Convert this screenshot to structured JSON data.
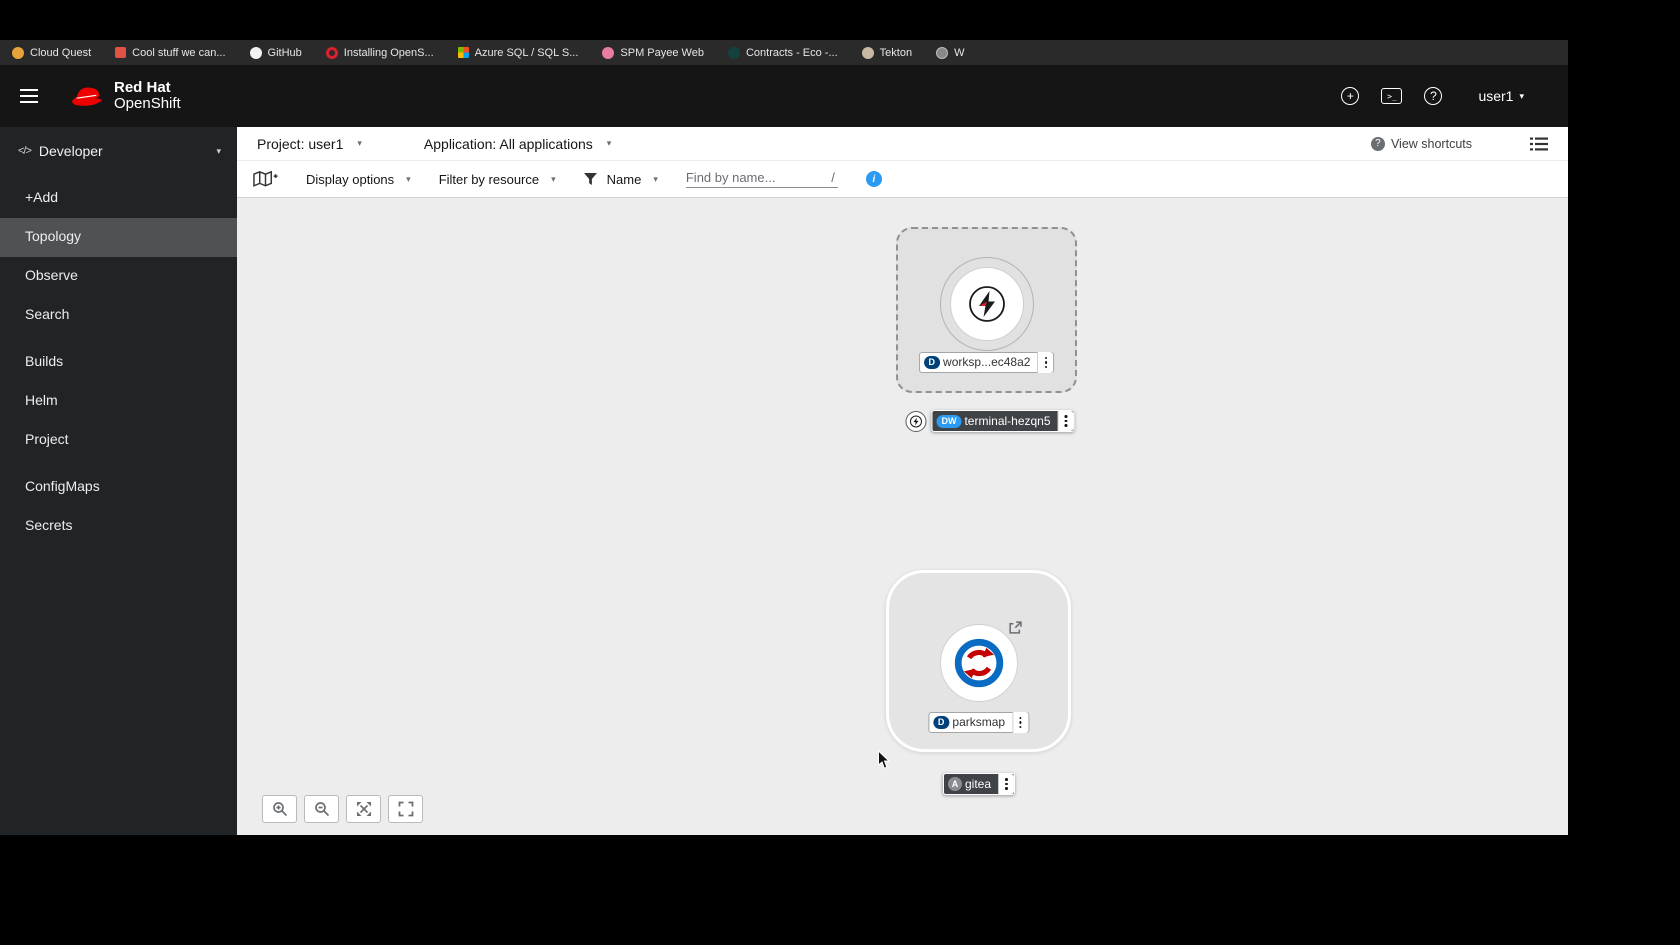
{
  "browser": {
    "bookmarks": [
      {
        "label": "Cloud Quest",
        "icon": "circle-yellow"
      },
      {
        "label": "Cool stuff we can...",
        "icon": "doc-red"
      },
      {
        "label": "GitHub",
        "icon": "github"
      },
      {
        "label": "Installing OpenS...",
        "icon": "openshift-ring"
      },
      {
        "label": "Azure SQL / SQL S...",
        "icon": "microsoft-grid"
      },
      {
        "label": "SPM Payee Web",
        "icon": "circle-pink"
      },
      {
        "label": "Contracts - Eco -...",
        "icon": "circle-dark"
      },
      {
        "label": "Tekton",
        "icon": "circle-tan"
      },
      {
        "label": "W",
        "icon": "globe"
      }
    ]
  },
  "masthead": {
    "brand_top": "Red Hat",
    "brand_bottom": "OpenShift",
    "username": "user1"
  },
  "sidebar": {
    "perspective": "Developer",
    "items": [
      {
        "label": "+Add"
      },
      {
        "label": "Topology"
      },
      {
        "label": "Observe"
      },
      {
        "label": "Search"
      },
      {
        "label": "Builds"
      },
      {
        "label": "Helm"
      },
      {
        "label": "Project"
      },
      {
        "label": "ConfigMaps"
      },
      {
        "label": "Secrets"
      }
    ]
  },
  "context_bar": {
    "project": "Project: user1",
    "application": "Application: All applications",
    "view_shortcuts": "View shortcuts"
  },
  "toolbar": {
    "display_options": "Display options",
    "filter_by_resource": "Filter by resource",
    "name_filter": "Name",
    "find_placeholder": "Find by name...",
    "shortcut": "/"
  },
  "topology": {
    "workspace": {
      "badge": "D",
      "label": "worksp...ec48a2"
    },
    "terminal": {
      "badge": "DW",
      "label": "terminal-hezqn5"
    },
    "parksmap": {
      "badge": "D",
      "label": "parksmap"
    },
    "gitea": {
      "badge": "A",
      "label": "gitea"
    }
  },
  "colors": {
    "brand_red": "#ee0000",
    "badge_navy": "#00417a",
    "badge_blue": "#2b9af3",
    "badge_gray": "#8a8d90",
    "info_blue": "#2b9af3",
    "parksmap_blue": "#0a6bc2",
    "parksmap_red": "#c40000"
  }
}
